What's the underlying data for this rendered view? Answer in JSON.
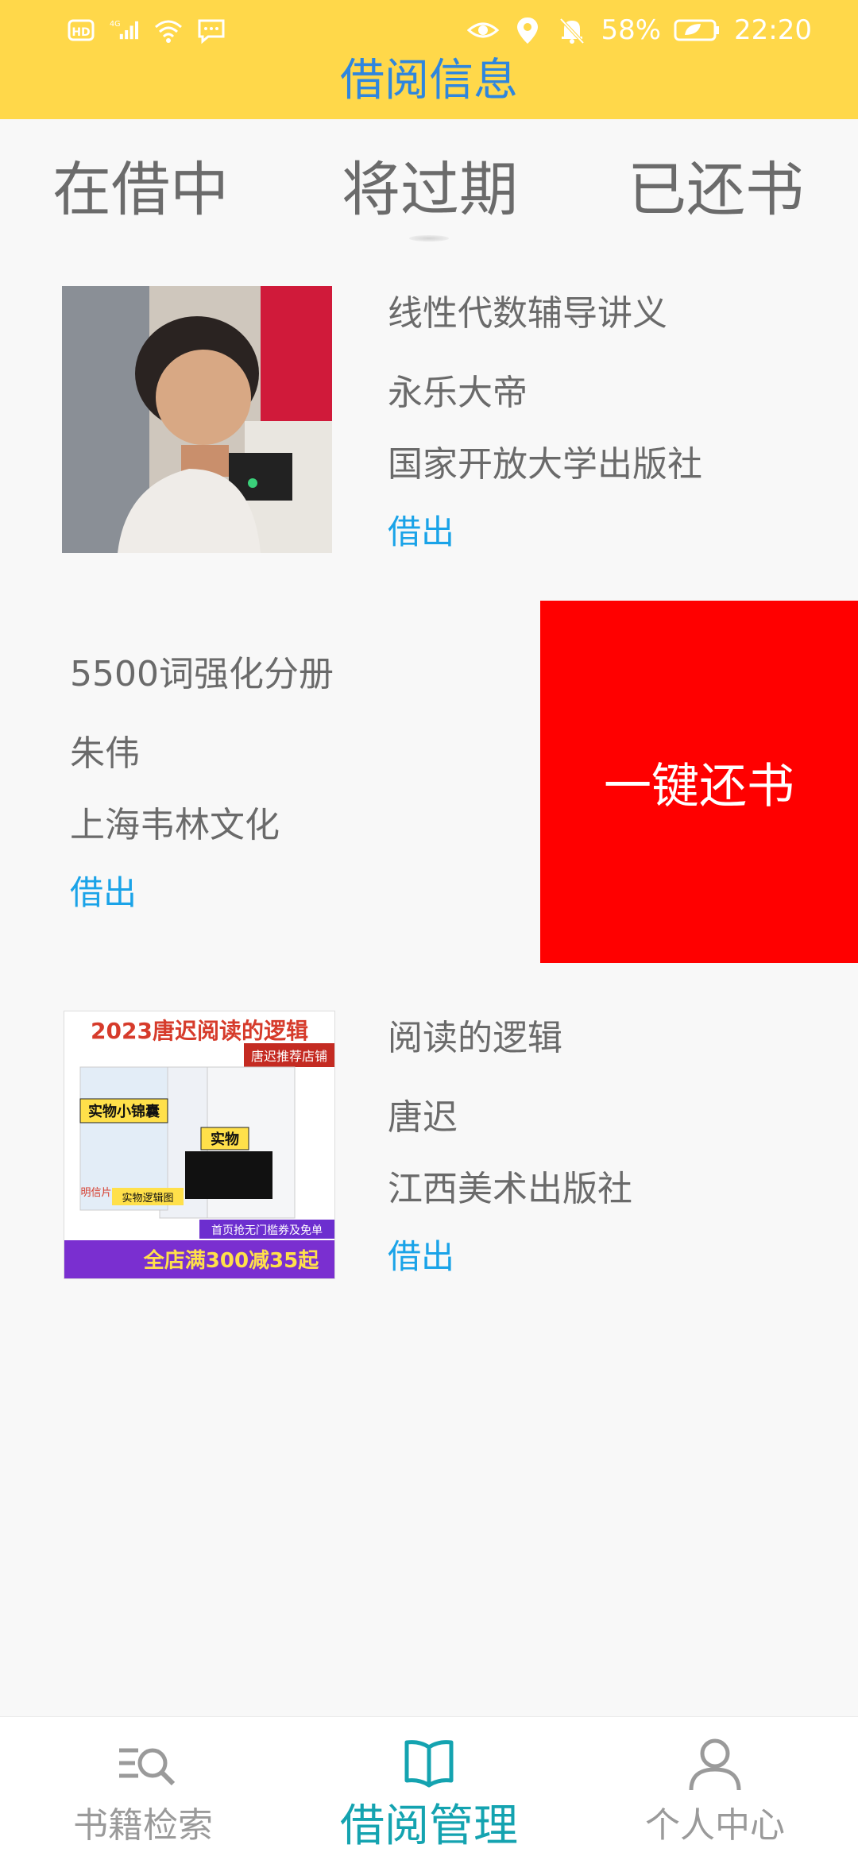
{
  "status_bar": {
    "left_icons": [
      "hd-icon",
      "signal-4g-icon",
      "wifi-icon",
      "message-icon"
    ],
    "network_label": "4G",
    "battery_percent": "58%",
    "time": "22:20"
  },
  "header": {
    "title": "借阅信息"
  },
  "tabs": [
    {
      "label": "在借中"
    },
    {
      "label": "将过期"
    },
    {
      "label": "已还书"
    }
  ],
  "active_tab_index": 1,
  "books": [
    {
      "title": "线性代数辅导讲义",
      "author": "永乐大帝",
      "publisher": "国家开放大学出版社",
      "status": "借出"
    },
    {
      "title": "5500词强化分册",
      "author": "朱伟",
      "publisher": "上海韦林文化",
      "status": "借出",
      "swipe_action": "一键还书"
    },
    {
      "title": "阅读的逻辑",
      "author": "唐迟",
      "publisher": "江西美术出版社",
      "status": "借出",
      "cover_text": {
        "headline": "2023唐迟阅读的逻辑",
        "shop": "唐迟推荐店铺",
        "tag1": "实物小锦囊",
        "tag2": "实物",
        "tag3": "实物逻辑图",
        "tag4": "明信片",
        "promo": "全店满300减35起",
        "promo2": "首页抢无门槛券及免单"
      }
    }
  ],
  "bottom_nav": [
    {
      "label": "书籍检索",
      "icon": "search-list-icon"
    },
    {
      "label": "借阅管理",
      "icon": "book-icon"
    },
    {
      "label": "个人中心",
      "icon": "user-icon"
    }
  ],
  "active_nav_index": 1,
  "colors": {
    "header_bg": "#FFD84A",
    "title": "#2e86de",
    "status_link": "#1aa3e8",
    "return_button": "#ff0000",
    "active_nav": "#14a3b0"
  }
}
